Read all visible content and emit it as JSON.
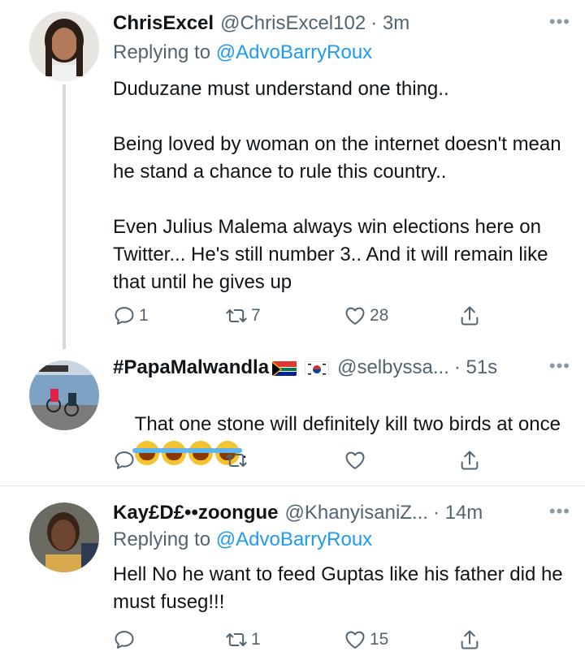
{
  "tweets": [
    {
      "name": "ChrisExcel",
      "handle": "@ChrisExcel102",
      "time": "· 3m",
      "replying_prefix": "Replying to ",
      "replying_to": "@AdvoBarryRoux",
      "text": "Duduzane must understand one thing..\n\nBeing loved by woman on the internet doesn't mean he stand a chance to rule this country..\n\nEven Julius Malema always win elections here on Twitter... He's still number 3.. And it will remain like that until he gives up",
      "reply_count": "1",
      "retweet_count": "7",
      "like_count": "28"
    },
    {
      "name": "#PapaMalwandla",
      "handle": "@selbyssa...",
      "time": "· 51s",
      "text": "That one stone will definitely kill two birds at once",
      "text_end": ".",
      "reply_count": "",
      "retweet_count": "",
      "like_count": ""
    },
    {
      "name": "Kay£D£••zoongue",
      "handle": "@KhanyisaniZ...",
      "time": "· 14m",
      "replying_prefix": "Replying to ",
      "replying_to": "@AdvoBarryRoux",
      "text": "Hell No he want to feed Guptas like his father did he must fuseg!!!",
      "reply_count": "",
      "retweet_count": "1",
      "like_count": "15"
    }
  ],
  "more_label": "•••",
  "colors": {
    "accent": "#1d9bf0",
    "secondary": "#536471",
    "text": "#0f1419"
  },
  "icons": [
    "reply-icon",
    "retweet-icon",
    "like-icon",
    "share-icon",
    "more-icon"
  ]
}
